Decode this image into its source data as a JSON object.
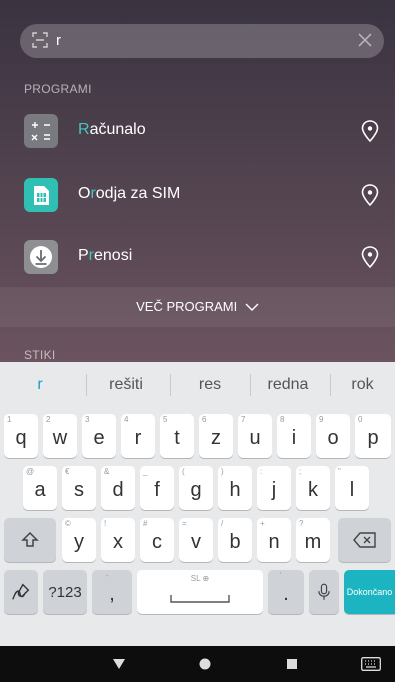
{
  "search": {
    "query": "r"
  },
  "sections": {
    "programs": "PROGRAMI",
    "contacts": "STIKI"
  },
  "apps": [
    {
      "highlight": "R",
      "rest": "ačunalo"
    },
    {
      "highlight": "",
      "pre": "O",
      "hl2": "r",
      "rest": "odja za SIM"
    },
    {
      "highlight": "",
      "pre": "P",
      "hl2": "r",
      "rest": "enosi"
    }
  ],
  "more": {
    "label": "VEČ PROGRAMI"
  },
  "suggestions": [
    "r",
    "rešiti",
    "res",
    "redna",
    "rok"
  ],
  "keys": {
    "row1": [
      [
        "q",
        "1"
      ],
      [
        "w",
        "2"
      ],
      [
        "e",
        "3"
      ],
      [
        "r",
        "4"
      ],
      [
        "t",
        "5"
      ],
      [
        "z",
        "6"
      ],
      [
        "u",
        "7"
      ],
      [
        "i",
        "8"
      ],
      [
        "o",
        "9"
      ],
      [
        "p",
        "0"
      ]
    ],
    "row2": [
      [
        "a",
        "@"
      ],
      [
        "s",
        "€"
      ],
      [
        "d",
        "&"
      ],
      [
        "f",
        "_"
      ],
      [
        "g",
        "("
      ],
      [
        "h",
        ")"
      ],
      [
        "j",
        ":"
      ],
      [
        "k",
        ";"
      ],
      [
        "l",
        "\""
      ]
    ],
    "row3": [
      [
        "y",
        "©"
      ],
      [
        "x",
        "!"
      ],
      [
        "c",
        "#"
      ],
      [
        "v",
        "="
      ],
      [
        "b",
        "/"
      ],
      [
        "n",
        "+"
      ],
      [
        "m",
        "?"
      ]
    ],
    "numbers": "?123",
    "comma": ",",
    "space": "SL ⊕",
    "period": ".",
    "enter": "Dokončano"
  }
}
